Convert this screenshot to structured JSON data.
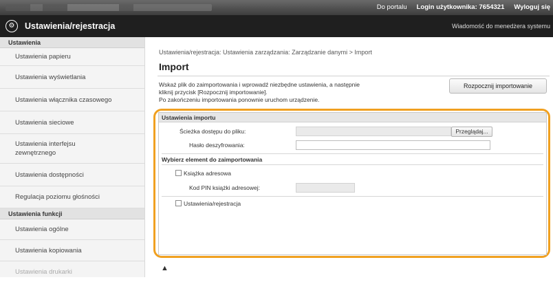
{
  "topbar": {
    "portal_link": "Do portalu",
    "login_text": "Login użytkownika: 7654321",
    "logout_link": "Wyloguj się"
  },
  "header": {
    "title": "Ustawienia/rejestracja",
    "message_link": "Wiadomość do menedżera systemu"
  },
  "sidebar": {
    "section1": "Ustawienia",
    "items1": [
      "Ustawienia papieru",
      "Ustawienia wyświetlania",
      "Ustawienia włącznika czasowego",
      "Ustawienia sieciowe",
      "Ustawienia interfejsu zewnętrznego",
      "Ustawienia dostępności",
      "Regulacja poziomu głośności"
    ],
    "section2": "Ustawienia funkcji",
    "items2": [
      "Ustawienia ogólne",
      "Ustawienia kopiowania",
      "Ustawienia drukarki"
    ]
  },
  "main": {
    "breadcrumb": "Ustawienia/rejestracja: Ustawienia zarządzania: Zarządzanie danymi > Import",
    "heading": "Import",
    "description_line1": "Wskaż plik do zaimportowania i wprowadź niezbędne ustawienia, a następnie",
    "description_line2": "kliknij przycisk [Rozpocznij importowanie].",
    "description_line3": "Po zakończeniu importowania ponownie uruchom urządzenie.",
    "start_button": "Rozpocznij importowanie",
    "panel_title": "Ustawienia importu",
    "file_path_label": "Ścieżka dostępu do pliku:",
    "file_path_value": "",
    "browse_button": "Przeglądaj...",
    "password_label": "Hasło deszyfrowania:",
    "password_value": "",
    "select_heading": "Wybierz element do zaimportowania",
    "address_book_label": "Książka adresowa",
    "address_book_checked": false,
    "pin_label": "Kod PIN książki adresowej:",
    "pin_value": "",
    "settings_label": "Ustawienia/rejestracja",
    "settings_checked": false,
    "to_top": "▲"
  }
}
